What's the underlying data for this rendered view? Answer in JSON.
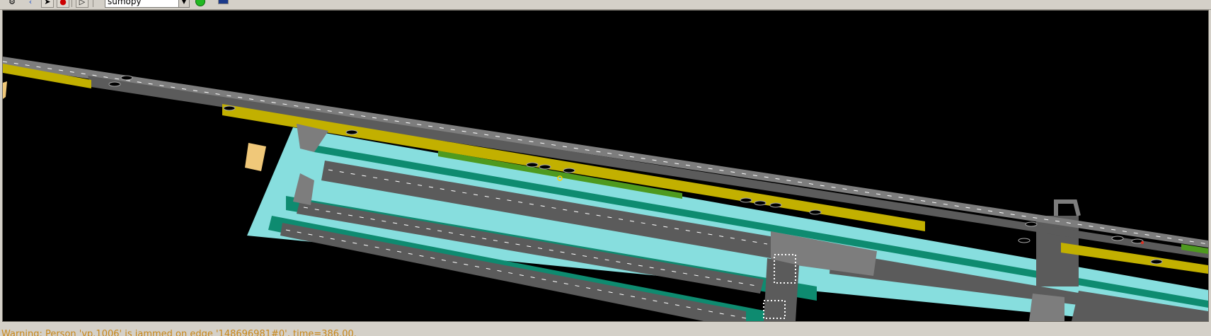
{
  "toolbar": {
    "scheme_select": {
      "value": "sumopy"
    },
    "icons": [
      "locate-icon",
      "back-icon",
      "select-icon",
      "stop-icon",
      "play-icon",
      "green-status-icon",
      "screenshot-icon"
    ]
  },
  "status_bar": {
    "message": "Warning: Person 'vp.1006' is jammed on edge '148696981#0', time=386.00."
  },
  "colors": {
    "background": "#000000",
    "road": "#5b5b5b",
    "road_light": "#7d7d7d",
    "bus_lane": "#c2b000",
    "bike_lane": "#4e9a1e",
    "sidewalk": "#87dede",
    "green_island": "#0e8b70",
    "building": "#f0c879",
    "status_text": "#c8871a"
  }
}
